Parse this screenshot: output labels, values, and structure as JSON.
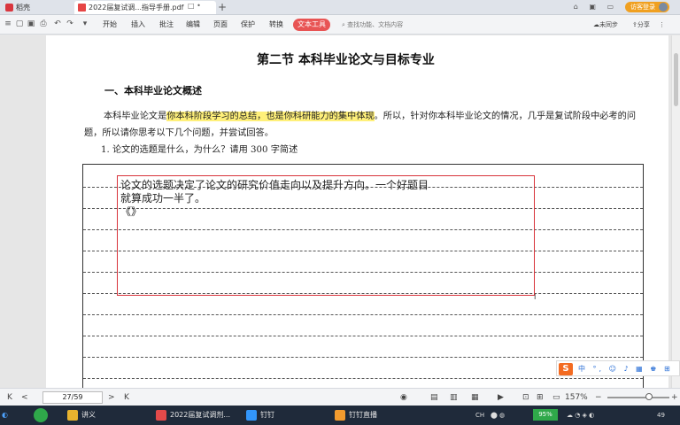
{
  "tabs": {
    "home": "稻壳",
    "doc": "2022届复试调...指导手册.pdf",
    "doc_extra": "□ •",
    "new_tab": "+"
  },
  "titlebar": {
    "icons": "⌂ ▣ ▭",
    "login": "访客登录"
  },
  "menu": {
    "items": [
      "开始",
      "插入",
      "批注",
      "编辑",
      "页面",
      "保护",
      "转换",
      "文本工具"
    ],
    "search_placeholder": "查找功能、文档内容",
    "right": [
      "未同步",
      "分享"
    ]
  },
  "doc": {
    "section_title": "第二节   本科毕业论文与目标专业",
    "subsection": "一、本科毕业论文概述",
    "para_start": "本科毕业论文是",
    "para_hl": "你本科阶段学习的总结，也是你科研能力的集中体现",
    "para_rest": "。所以，针对你本科毕业论文的情况，几乎是复试阶段中必考的问题，所以请你思考以下几个问题，并尝试回答。",
    "question": "1.  论文的选题是什么，为什么？请用 300 字简述",
    "answer_line1": "论文的选题决定了论文的研究价值走向以及提升方向。一个好题目",
    "answer_line2": "就算成功一半了。",
    "answer_line3": "《》",
    "cursor": "I"
  },
  "ime": {
    "logo": "S",
    "items": "中 °, ☺ ♪ ▦ ♚ ⊞"
  },
  "status": {
    "first": "K",
    "prev": "<",
    "page": "27/59",
    "next": ">",
    "last": "K",
    "zoom": "157%",
    "zoom_minus": "−",
    "zoom_plus": "+"
  },
  "taskbar": {
    "apps": [
      "讲义",
      "2022届复试调剂...",
      "钉钉",
      "钉钉直播"
    ],
    "battery": "95%",
    "tray_lang": "CH",
    "tray_num": "49"
  },
  "colors": {
    "accent": "#e85454",
    "highlight": "#fff07a",
    "annotation": "#d8333a"
  }
}
